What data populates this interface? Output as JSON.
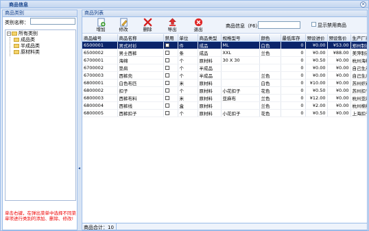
{
  "window": {
    "title": "商品信息",
    "close_glyph": "×"
  },
  "left": {
    "header": "商品类别",
    "category_label": "类别名称：",
    "category_value": "",
    "tree": {
      "root": "所有类别",
      "children": [
        "成品类",
        "半成品类",
        "原材料类"
      ]
    },
    "hint": "单击右键，在弹出菜单中选择不同菜单项进行类别的添加、删除、修改!"
  },
  "right": {
    "header": "商品列表",
    "toolbar": {
      "add": "增加",
      "edit": "修改",
      "delete": "删除",
      "export": "导出",
      "exit": "退出",
      "search_label": "商品信息（F6）：",
      "search_value": "",
      "show_disabled_label": "显示禁用商品"
    },
    "columns": [
      "商品编号",
      "商品名称",
      "禁用",
      "单位",
      "商品类型",
      "规格型号",
      "颜色",
      "最低库存",
      "预设进价",
      "预设售价",
      "生产厂商"
    ],
    "rows": [
      [
        "6500001",
        "男式衬衫",
        "",
        "件",
        "成品",
        "ML",
        "白色",
        "0",
        "¥0.00",
        "¥53.00",
        "郑州制衣厂"
      ],
      [
        "6500002",
        "男士西裤",
        "",
        "条",
        "成品",
        "XXL",
        "兰色",
        "0",
        "¥0.00",
        "¥88.00",
        "美萍制衣厂"
      ],
      [
        "6700001",
        "海绵",
        "",
        "个",
        "原材料",
        "30 X 30",
        "",
        "0",
        "¥0.50",
        "¥0.00",
        "杭州海绵厂"
      ],
      [
        "6700002",
        "垫肩",
        "",
        "个",
        "半成品",
        "",
        "",
        "0",
        "¥0.00",
        "¥0.00",
        "自己生产"
      ],
      [
        "6700003",
        "西裤壳",
        "",
        "个",
        "半成品",
        "",
        "兰色",
        "0",
        "¥0.00",
        "¥0.00",
        "自己生产"
      ],
      [
        "6800001",
        "白色布匹",
        "",
        "米",
        "原材料",
        "",
        "白色",
        "0",
        "¥10.00",
        "¥0.00",
        "苏州织布厂"
      ],
      [
        "6800002",
        "扣子",
        "",
        "个",
        "原材料",
        "小花扣子",
        "花色",
        "0",
        "¥0.50",
        "¥0.00",
        "苏州扣子厂"
      ],
      [
        "6800003",
        "西裤布料",
        "",
        "米",
        "原材料",
        "亚麻布",
        "兰色",
        "0",
        "¥12.00",
        "¥0.00",
        "杭州亚麻织"
      ],
      [
        "6800004",
        "西裤线",
        "",
        "盒",
        "原材料",
        "",
        "兰色",
        "0",
        "¥2.00",
        "¥0.00",
        "杭州棉线厂"
      ],
      [
        "6800005",
        "西裤扣子",
        "",
        "个",
        "原材料",
        "小花扣子",
        "花色",
        "0",
        "¥0.50",
        "¥0.00",
        "上海扣子厂"
      ]
    ],
    "selected_row": 0,
    "footer_total": "商品合计：10"
  },
  "icons": {
    "add": "add-icon",
    "edit": "edit-icon",
    "delete": "delete-icon",
    "export": "export-icon",
    "exit": "exit-icon",
    "folder": "folder-icon"
  }
}
